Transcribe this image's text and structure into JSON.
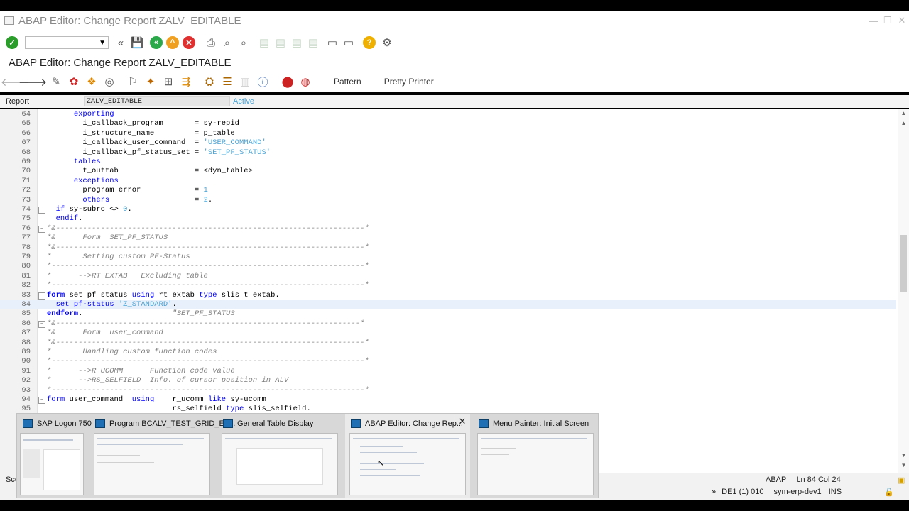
{
  "window": {
    "title": "ABAP Editor: Change Report ZALV_EDITABLE"
  },
  "screen_title": "ABAP Editor: Change Report ZALV_EDITABLE",
  "app_toolbar": {
    "pattern_label": "Pattern",
    "pretty_printer_label": "Pretty Printer"
  },
  "report_bar": {
    "label": "Report",
    "value": "ZALV_EDITABLE",
    "status": "Active"
  },
  "code_lines": [
    {
      "n": "64",
      "html": "      <span class='kw'>exporting</span>"
    },
    {
      "n": "65",
      "html": "        i_callback_program       = sy-repid"
    },
    {
      "n": "66",
      "html": "        i_structure_name         = p_table"
    },
    {
      "n": "67",
      "html": "        i_callback_user_command  = <span class='st'>'USER_COMMAND'</span>"
    },
    {
      "n": "68",
      "html": "        i_callback_pf_status_set = <span class='st'>'SET_PF_STATUS'</span>"
    },
    {
      "n": "69",
      "html": "      <span class='kw'>tables</span>"
    },
    {
      "n": "70",
      "html": "        t_outtab                 = &lt;dyn_table&gt;"
    },
    {
      "n": "71",
      "html": "      <span class='kw'>exceptions</span>"
    },
    {
      "n": "72",
      "html": "        program_error            = <span class='num'>1</span>"
    },
    {
      "n": "73",
      "html": "        <span class='kw'>others</span>                   = <span class='num'>2</span>."
    },
    {
      "n": "74",
      "html": "  <span class='kw'>if</span> sy-subrc &lt;&gt; <span class='num'>0</span>.",
      "fold": "⊟"
    },
    {
      "n": "75",
      "html": "  <span class='kw'>endif</span>."
    },
    {
      "n": "76",
      "html": "<span class='cm'>*&amp;---------------------------------------------------------------------*</span>",
      "fold": "⊟"
    },
    {
      "n": "77",
      "html": "<span class='cm'>*&amp;      Form  SET_PF_STATUS</span>"
    },
    {
      "n": "78",
      "html": "<span class='cm'>*&amp;---------------------------------------------------------------------*</span>"
    },
    {
      "n": "79",
      "html": "<span class='cm'>*       Setting custom PF-Status</span>"
    },
    {
      "n": "80",
      "html": "<span class='cm'>*----------------------------------------------------------------------*</span>"
    },
    {
      "n": "81",
      "html": "<span class='cm'>*      --&gt;RT_EXTAB   Excluding table</span>"
    },
    {
      "n": "82",
      "html": "<span class='cm'>*----------------------------------------------------------------------*</span>"
    },
    {
      "n": "83",
      "html": "<b><span class='kw'>form</span></b> set_pf_status <span class='kw'>using</span> rt_extab <span class='kw'>type</span> slis_t_extab.",
      "fold": "⊟"
    },
    {
      "n": "84",
      "html": "  <span class='kw'>set pf-status</span> <span class='st'>'Z_STANDARD'</span>.",
      "hl": true
    },
    {
      "n": "85",
      "html": "<b><span class='kw'>endform</span></b>.                    <span class='cm'>\"SET_PF_STATUS</span>"
    },
    {
      "n": "86",
      "html": "<span class='cm'>*&amp;--------------------------------------------------------------------*</span>",
      "fold": "⊟"
    },
    {
      "n": "87",
      "html": "<span class='cm'>*&amp;      Form  user_command</span>"
    },
    {
      "n": "88",
      "html": "<span class='cm'>*&amp;---------------------------------------------------------------------*</span>"
    },
    {
      "n": "89",
      "html": "<span class='cm'>*       Handling custom function codes</span>"
    },
    {
      "n": "90",
      "html": "<span class='cm'>*----------------------------------------------------------------------*</span>"
    },
    {
      "n": "91",
      "html": "<span class='cm'>*      --&gt;R_UCOMM      Function code value</span>"
    },
    {
      "n": "92",
      "html": "<span class='cm'>*      --&gt;RS_SELFIELD  Info. of cursor position in ALV</span>"
    },
    {
      "n": "93",
      "html": "<span class='cm'>*----------------------------------------------------------------------*</span>"
    },
    {
      "n": "94",
      "html": "<span class='kw'>form</span> user_command  <span class='kw'>using</span>    r_ucomm <span class='kw'>like</span> sy-ucomm",
      "fold": "⊟"
    },
    {
      "n": "95",
      "html": "                            rs_selfield <span class='kw'>type</span> slis_selfield."
    }
  ],
  "status": {
    "language": "ABAP",
    "position": "Ln  84 Col  24",
    "system": "DE1 (1) 010",
    "server": "sym-erp-dev1",
    "mode": "INS",
    "left_text": "Sco"
  },
  "taskbar_thumbnails": [
    {
      "title": "SAP Logon 750"
    },
    {
      "title": "Program BCALV_TEST_GRID_EV..."
    },
    {
      "title": "General Table Display"
    },
    {
      "title": "ABAP Editor: Change Rep..."
    },
    {
      "title": "Menu Painter: Initial Screen"
    }
  ]
}
